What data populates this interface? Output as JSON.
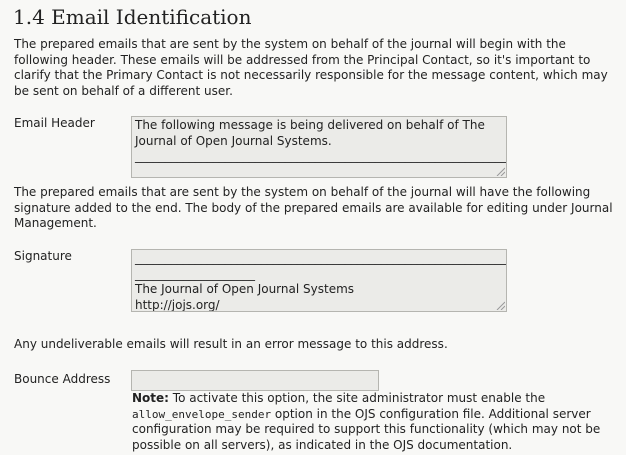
{
  "section": {
    "title": "1.4 Email Identification"
  },
  "intro_text": "The prepared emails that are sent by the system on behalf of the journal will begin with the following header. These emails will be addressed from the Principal Contact, so it's important to clarify that the Primary Contact is not necessarily responsible for the message content, which may be sent on behalf of a different user.",
  "email_header": {
    "label": "Email Header",
    "lines": [
      "The following message is being delivered on behalf of The",
      "Journal of Open Journal Systems.",
      "________________________________________________________________",
      "____________________"
    ]
  },
  "signature_intro_text": "The prepared emails that are sent by the system on behalf of the journal will have the following signature added to the end. The body of the prepared emails are available for editing under Journal Management.",
  "signature": {
    "label": "Signature",
    "lines": [
      "________________________________________________________________",
      "____________________",
      "The Journal of Open Journal Systems",
      "http://jojs.org/"
    ]
  },
  "bounce_intro_text": "Any undeliverable emails will result in an error message to this address.",
  "bounce": {
    "label": "Bounce Address",
    "value": "",
    "note_label": "Note:",
    "note_text_1": " To activate this option, the site administrator must enable the ",
    "note_code": "allow_envelope_sender",
    "note_text_2": " option in the OJS configuration file. Additional server configuration may be required to support this functionality (which may not be possible on all servers), as indicated in the OJS documentation."
  }
}
